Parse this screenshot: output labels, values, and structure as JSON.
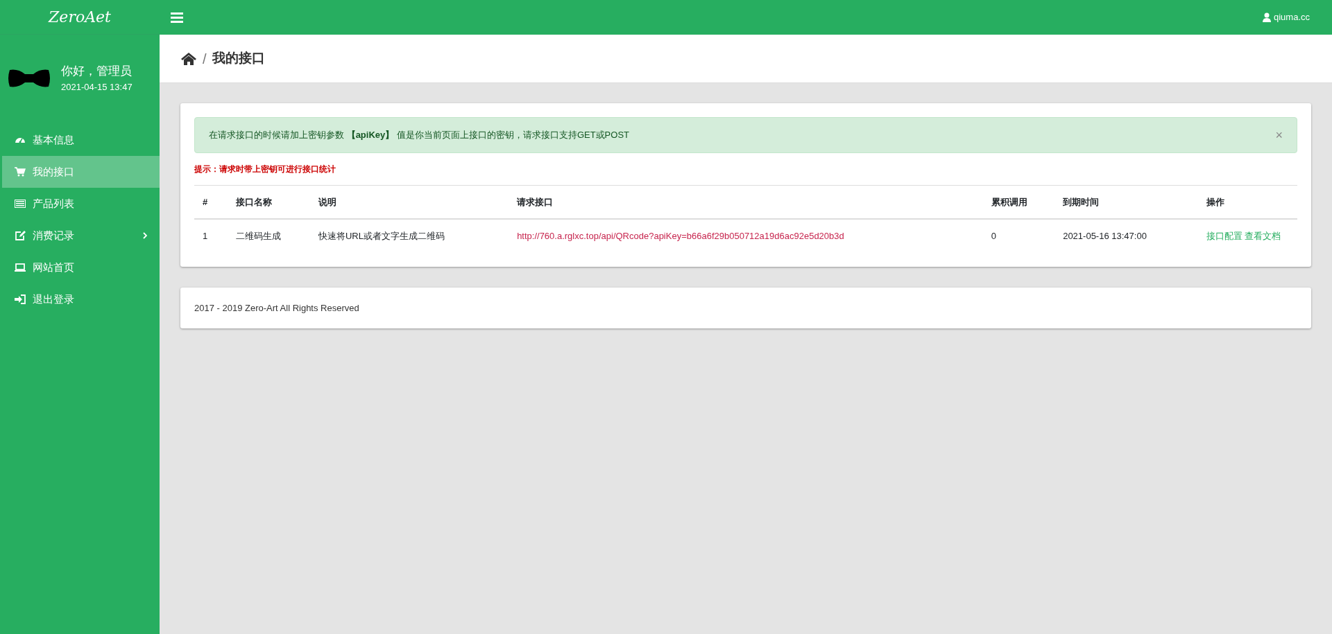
{
  "brand": "ZeroAet",
  "user": {
    "name": "qiuma.cc"
  },
  "profile": {
    "greeting": "你好，管理员",
    "time": "2021-04-15 13:47"
  },
  "sidebar": {
    "items": [
      {
        "label": "基本信息",
        "selected": false,
        "has_children": false
      },
      {
        "label": "我的接口",
        "selected": true,
        "has_children": false
      },
      {
        "label": "产品列表",
        "selected": false,
        "has_children": false
      },
      {
        "label": "消费记录",
        "selected": false,
        "has_children": true
      },
      {
        "label": "网站首页",
        "selected": false,
        "has_children": false
      },
      {
        "label": "退出登录",
        "selected": false,
        "has_children": false
      }
    ]
  },
  "breadcrumb": {
    "separator": "/",
    "title": "我的接口"
  },
  "alert": {
    "text": "在请求接口的时候请加上密钥参数 **【apiKey】** 值是你当前页面上接口的密钥，请求接口支持GET或POST",
    "close": "×"
  },
  "hint": "提示：请求时带上密钥可进行接口统计",
  "table": {
    "columns": [
      "#",
      "接口名称",
      "说明",
      "请求接口",
      "累积调用",
      "到期时间",
      "操作"
    ],
    "rows": [
      {
        "index": "1",
        "name": "二维码生成",
        "description": "快速将URL或者文字生成二维码",
        "url": "http://760.a.rglxc.top/api/QRcode?apiKey=b66a6f29b050712a19d6ac92e5d20b3d",
        "calls": "0",
        "expires": "2021-05-16 13:47:00",
        "actions": [
          "接口配置",
          "查看文档"
        ]
      }
    ]
  },
  "footer": "2017 - 2019 Zero-Art All Rights Reserved"
}
